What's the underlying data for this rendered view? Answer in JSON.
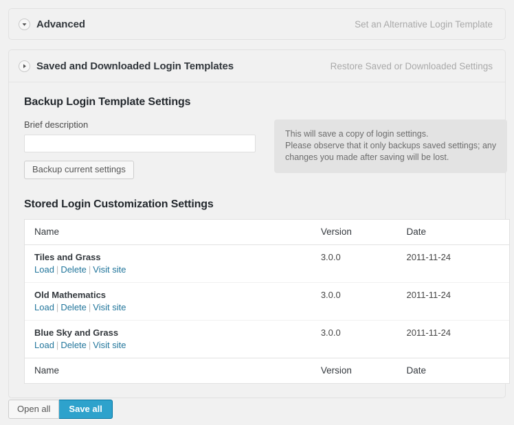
{
  "panels": [
    {
      "id": "advanced",
      "title": "Advanced",
      "subtitle": "Set an Alternative Login Template",
      "icon": "chevron-down-circle-icon",
      "expanded": true
    },
    {
      "id": "saved-downloaded",
      "title": "Saved and Downloaded Login Templates",
      "subtitle": "Restore Saved or Downloaded Settings",
      "icon": "chevron-right-circle-icon",
      "expanded": false
    }
  ],
  "backup": {
    "section_title": "Backup Login Template Settings",
    "field_label": "Brief description",
    "input_value": "",
    "input_placeholder": "",
    "button_label": "Backup current settings",
    "info_lines": [
      "This will save a copy of login settings.",
      "Please observe that it only backups saved settings; any",
      "changes you made after saving will be lost."
    ]
  },
  "stored": {
    "section_title": "Stored Login Customization Settings",
    "columns": [
      "Name",
      "Version",
      "Date"
    ],
    "actions": {
      "load": "Load",
      "delete": "Delete",
      "visit": "Visit site",
      "separator": "|"
    },
    "rows": [
      {
        "name": "Tiles and Grass",
        "version": "3.0.0",
        "date": "2011-11-24"
      },
      {
        "name": "Old Mathematics",
        "version": "3.0.0",
        "date": "2011-11-24"
      },
      {
        "name": "Blue Sky and Grass",
        "version": "3.0.0",
        "date": "2011-11-24"
      }
    ]
  },
  "footer": {
    "open_all": "Open all",
    "save_all": "Save all"
  },
  "colors": {
    "accent_blue": "#2ea2cc",
    "link_blue": "#21759b",
    "page_bg": "#f1f1f1",
    "info_bg": "#e3e3e3"
  }
}
